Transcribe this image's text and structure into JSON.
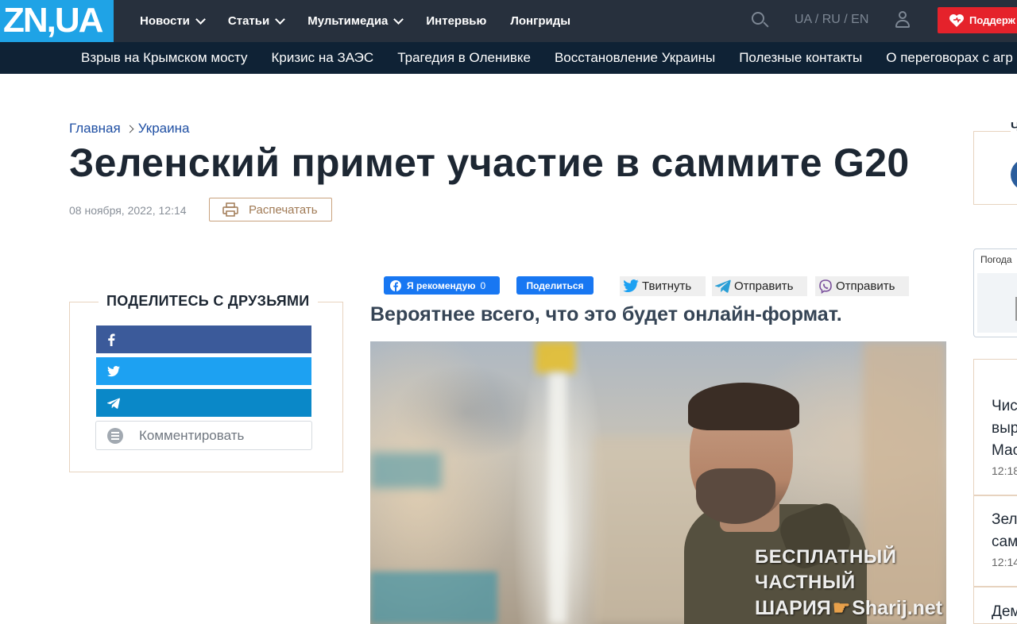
{
  "header": {
    "logo": "ZN,UA",
    "nav": [
      {
        "label": "Новости",
        "dropdown": true
      },
      {
        "label": "Статьи",
        "dropdown": true
      },
      {
        "label": "Мультимедиа",
        "dropdown": true
      },
      {
        "label": "Интервью",
        "dropdown": false
      },
      {
        "label": "Лонгриды",
        "dropdown": false
      }
    ],
    "lang": {
      "ua": "UA",
      "ru": "RU",
      "en": "EN",
      "sep": " / "
    },
    "support_label": "Поддерж"
  },
  "tagbar": [
    "Взрыв на Крымском мосту",
    "Кризис на ЗАЭС",
    "Трагедия в Оленивке",
    "Восстановление Украины",
    "Полезные контакты",
    "О переговорах с агр"
  ],
  "breadcrumb": {
    "home": "Главная",
    "section": "Украина"
  },
  "article": {
    "title": "Зеленский примет участие в саммите G20",
    "date": "08 ноября, 2022, 12:14",
    "print_label": "Распечатать",
    "lead": "Вероятнее всего, что это будет онлайн-формат."
  },
  "share": {
    "title": "ПОДЕЛИТЕСЬ С ДРУЗЬЯМИ",
    "comment_label": "Комментировать"
  },
  "social": {
    "fb_like": "Я рекомендую",
    "fb_like_count": "0",
    "fb_share": "Поделиться",
    "tweet": "Твитнуть",
    "telegram": "Отправить",
    "viber": "Отправить"
  },
  "watermark": {
    "line1": "БЕСПЛАТНЫЙ ЧАСТНЫЙ",
    "line2": "ШАРИЯ",
    "line2b": "Sharij.net"
  },
  "right": {
    "box_letter": "Ч",
    "weather_label": "Погода",
    "news": [
      {
        "lines": [
          "Чис",
          "выр",
          "Мас"
        ],
        "time": "12:18"
      },
      {
        "lines": [
          "Зел",
          "сам"
        ],
        "time": "12:14"
      },
      {
        "lines": [
          "Дем"
        ],
        "time": ""
      }
    ]
  },
  "colors": {
    "header_bg": "#27303d",
    "logo_bg": "#1fa3e6",
    "tagbar_bg": "#0f2235",
    "support": "#e5222b",
    "facebook": "#3b5a9a",
    "twitter": "#1da1f2",
    "telegram": "#0a88c8",
    "fb_button": "#1877f2",
    "accent_border": "#e7d3bf"
  }
}
